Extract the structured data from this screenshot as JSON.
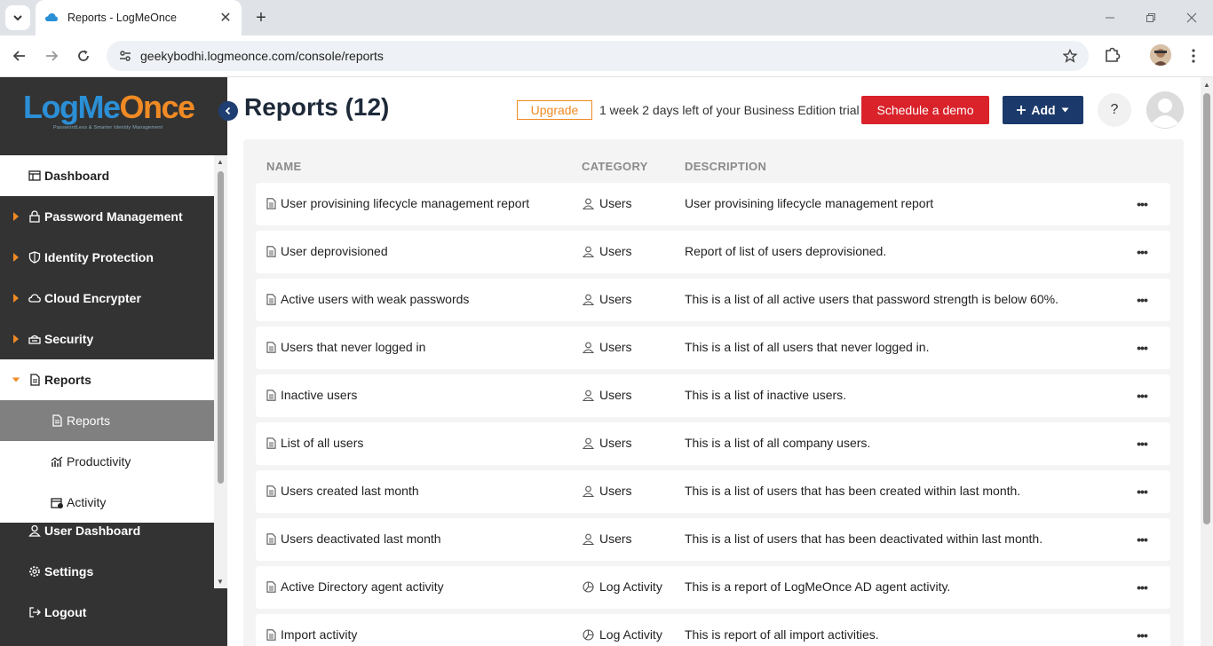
{
  "browser": {
    "tab_title": "Reports - LogMeOnce",
    "url": "geekybodhi.logmeonce.com/console/reports",
    "new_tab_symbol": "+",
    "close_symbol": "✕"
  },
  "sidebar": {
    "logo_text_1": "LogMe",
    "logo_text_2": "Once",
    "logo_tagline": "PasswordLess & Smarter Identity Management",
    "items": [
      {
        "label": "Dashboard",
        "icon": "dashboard-icon"
      },
      {
        "label": "Password Management",
        "icon": "lock-icon"
      },
      {
        "label": "Identity Protection",
        "icon": "shield-icon"
      },
      {
        "label": "Cloud Encrypter",
        "icon": "cloud-icon"
      },
      {
        "label": "Security",
        "icon": "security-icon"
      },
      {
        "label": "Reports",
        "icon": "report-icon"
      }
    ],
    "sub_items": [
      {
        "label": "Reports",
        "icon": "report-icon"
      },
      {
        "label": "Productivity",
        "icon": "chart-icon"
      },
      {
        "label": "Activity",
        "icon": "calendar-icon"
      }
    ],
    "bottom_items": [
      {
        "label": "User Dashboard",
        "icon": "user-icon"
      },
      {
        "label": "Settings",
        "icon": "gear-icon"
      },
      {
        "label": "Logout",
        "icon": "logout-icon"
      }
    ],
    "accent_color": "#f08a24"
  },
  "header": {
    "title": "Reports (12)",
    "upgrade_label": "Upgrade",
    "trial_text": "1 week 2 days left of your Business Edition trial",
    "demo_label": "Schedule a demo",
    "add_label": "Add",
    "help_label": "?"
  },
  "table": {
    "columns": [
      "NAME",
      "CATEGORY",
      "DESCRIPTION"
    ],
    "rows": [
      {
        "name": "User provisining lifecycle management report",
        "category": "Users",
        "description": "User provisining lifecycle management report"
      },
      {
        "name": "User deprovisioned",
        "category": "Users",
        "description": "Report of list of users deprovisioned."
      },
      {
        "name": "Active users with weak passwords",
        "category": "Users",
        "description": "This is a list of all active users that password strength is below 60%."
      },
      {
        "name": "Users that never logged in",
        "category": "Users",
        "description": "This is a list of all users that never logged in."
      },
      {
        "name": "Inactive users",
        "category": "Users",
        "description": "This is a list of inactive users."
      },
      {
        "name": "List of all users",
        "category": "Users",
        "description": "This is a list of all company users."
      },
      {
        "name": "Users created last month",
        "category": "Users",
        "description": "This is a list of users that has been created within last month."
      },
      {
        "name": "Users deactivated last month",
        "category": "Users",
        "description": "This is a list of users that has been deactivated within last month."
      },
      {
        "name": "Active Directory agent activity",
        "category": "Log Activity",
        "description": "This is a report of LogMeOnce AD agent activity."
      },
      {
        "name": "Import activity",
        "category": "Log Activity",
        "description": "This is report of all import activities."
      }
    ],
    "more_symbol": "•••"
  }
}
